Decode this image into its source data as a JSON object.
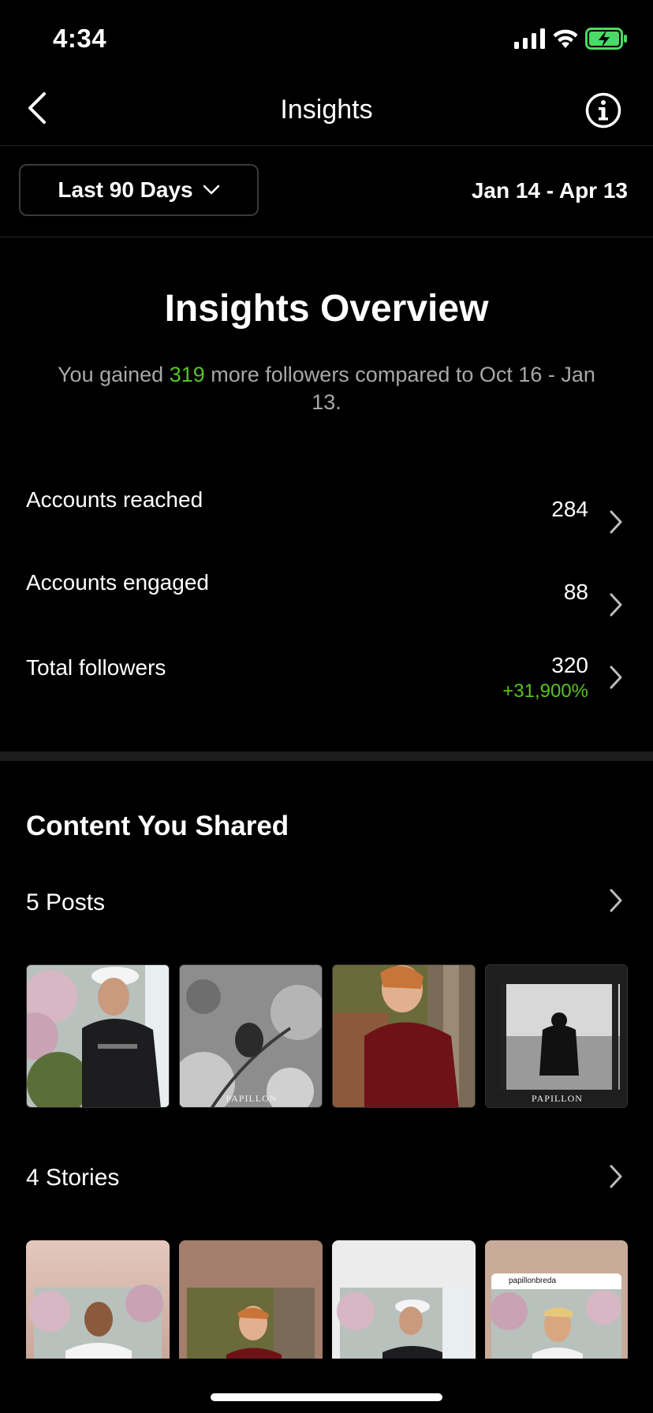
{
  "status_bar": {
    "time": "4:34"
  },
  "header": {
    "title": "Insights"
  },
  "range": {
    "selector_label": "Last 90 Days",
    "date_range": "Jan 14 - Apr 13"
  },
  "overview": {
    "title": "Insights Overview",
    "sub_prefix": "You gained ",
    "sub_highlight": "319",
    "sub_suffix": " more followers compared to Oct 16 - Jan 13."
  },
  "metrics": [
    {
      "label": "Accounts reached",
      "value": "284"
    },
    {
      "label": "Accounts engaged",
      "value": "88"
    },
    {
      "label": "Total followers",
      "value": "320",
      "delta": "+31,900%"
    }
  ],
  "content": {
    "title": "Content You Shared",
    "posts_label": "5 Posts",
    "stories_label": "4 Stories",
    "post_thumbs": [
      {
        "caption": ""
      },
      {
        "caption": "PAPILLON"
      },
      {
        "caption": ""
      },
      {
        "caption": "PAPILLON"
      }
    ],
    "story_thumbs": [
      {
        "caption": ""
      },
      {
        "caption": ""
      },
      {
        "caption": ""
      },
      {
        "caption": "papillonbreda"
      }
    ]
  },
  "colors": {
    "positive": "#58c322",
    "background": "#000000"
  }
}
